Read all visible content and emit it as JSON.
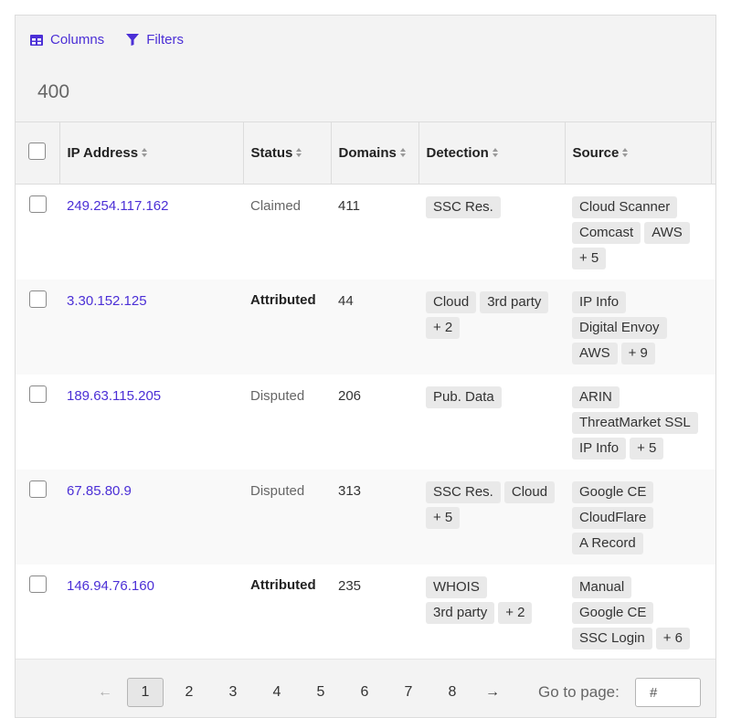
{
  "toolbar": {
    "columns_label": "Columns",
    "filters_label": "Filters"
  },
  "result_count": "400",
  "table": {
    "headers": [
      "IP Address",
      "Status",
      "Domains",
      "Detection",
      "Source"
    ],
    "rows": [
      {
        "ip": "249.254.117.162",
        "status": "Claimed",
        "domains": "411",
        "detection": [
          "SSC Res."
        ],
        "source": [
          "Cloud Scanner",
          "Comcast",
          "AWS",
          "+ 5"
        ]
      },
      {
        "ip": "3.30.152.125",
        "status": "Attributed",
        "domains": "44",
        "detection": [
          "Cloud",
          "3rd party",
          "+ 2"
        ],
        "source": [
          "IP Info",
          "Digital Envoy",
          "AWS",
          "+ 9"
        ]
      },
      {
        "ip": "189.63.115.205",
        "status": "Disputed",
        "domains": "206",
        "detection": [
          "Pub. Data"
        ],
        "source": [
          "ARIN",
          "ThreatMarket SSL",
          "IP Info",
          "+ 5"
        ]
      },
      {
        "ip": "67.85.80.9",
        "status": "Disputed",
        "domains": "313",
        "detection": [
          "SSC Res.",
          "Cloud",
          "+ 5"
        ],
        "source": [
          "Google CE",
          "CloudFlare",
          "A Record"
        ]
      },
      {
        "ip": "146.94.76.160",
        "status": "Attributed",
        "domains": "235",
        "detection": [
          "WHOIS",
          "3rd party",
          "+ 2"
        ],
        "source": [
          "Manual",
          "Google CE",
          "SSC Login",
          "+ 6"
        ]
      }
    ]
  },
  "pagination": {
    "prev": "←",
    "next": "→",
    "pages": [
      "1",
      "2",
      "3",
      "4",
      "5",
      "6",
      "7",
      "8"
    ],
    "current_page": "1",
    "goto_label": "Go to page:",
    "goto_placeholder": "#"
  },
  "colors": {
    "accent": "#4b2fd6"
  }
}
